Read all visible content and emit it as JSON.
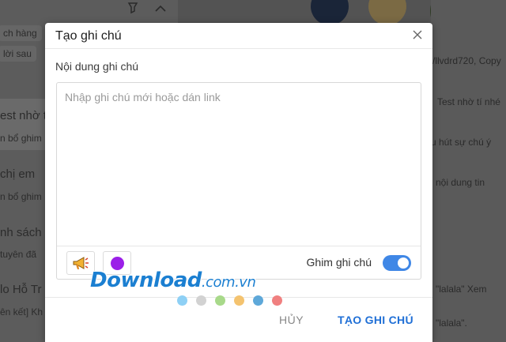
{
  "background": {
    "left_snippets": [
      "ch hàng",
      "lời sau",
      "est nhờ t",
      "n bổ ghim",
      "chị em",
      "n bổ ghim",
      "nh sách",
      "tuyên đã",
      "lo Hỗ Tr",
      "ên kết] Kh"
    ],
    "right_snippets": [
      "/llvdrd720, Copy",
      "Test nhờ tí nhé",
      "u hút sự chú ý",
      "nội dung tin",
      "\"lalala\" Xem",
      "\"lalala\"."
    ]
  },
  "modal": {
    "title": "Tạo ghi chú",
    "close_icon": "close-icon",
    "field_label": "Nội dung ghi chú",
    "note_input": {
      "placeholder": "Nhập ghi chú mới hoặc dán link",
      "value": ""
    },
    "toolbar": {
      "megaphone_icon": "megaphone-icon",
      "selected_color": "#9b1fe8",
      "pin_label": "Ghim ghi chú",
      "pin_enabled": true,
      "toggle_color": "#3f87e6"
    },
    "cancel_label": "HỦY",
    "create_label": "TẠO GHI CHÚ",
    "accent": "#1f6fd6"
  },
  "watermark": {
    "brand": "Download",
    "tld": ".com.vn",
    "dot_colors": [
      "#8ed0f5",
      "#d2d2d2",
      "#a8d98a",
      "#f4c36f",
      "#5ea8d9",
      "#f08080"
    ]
  }
}
